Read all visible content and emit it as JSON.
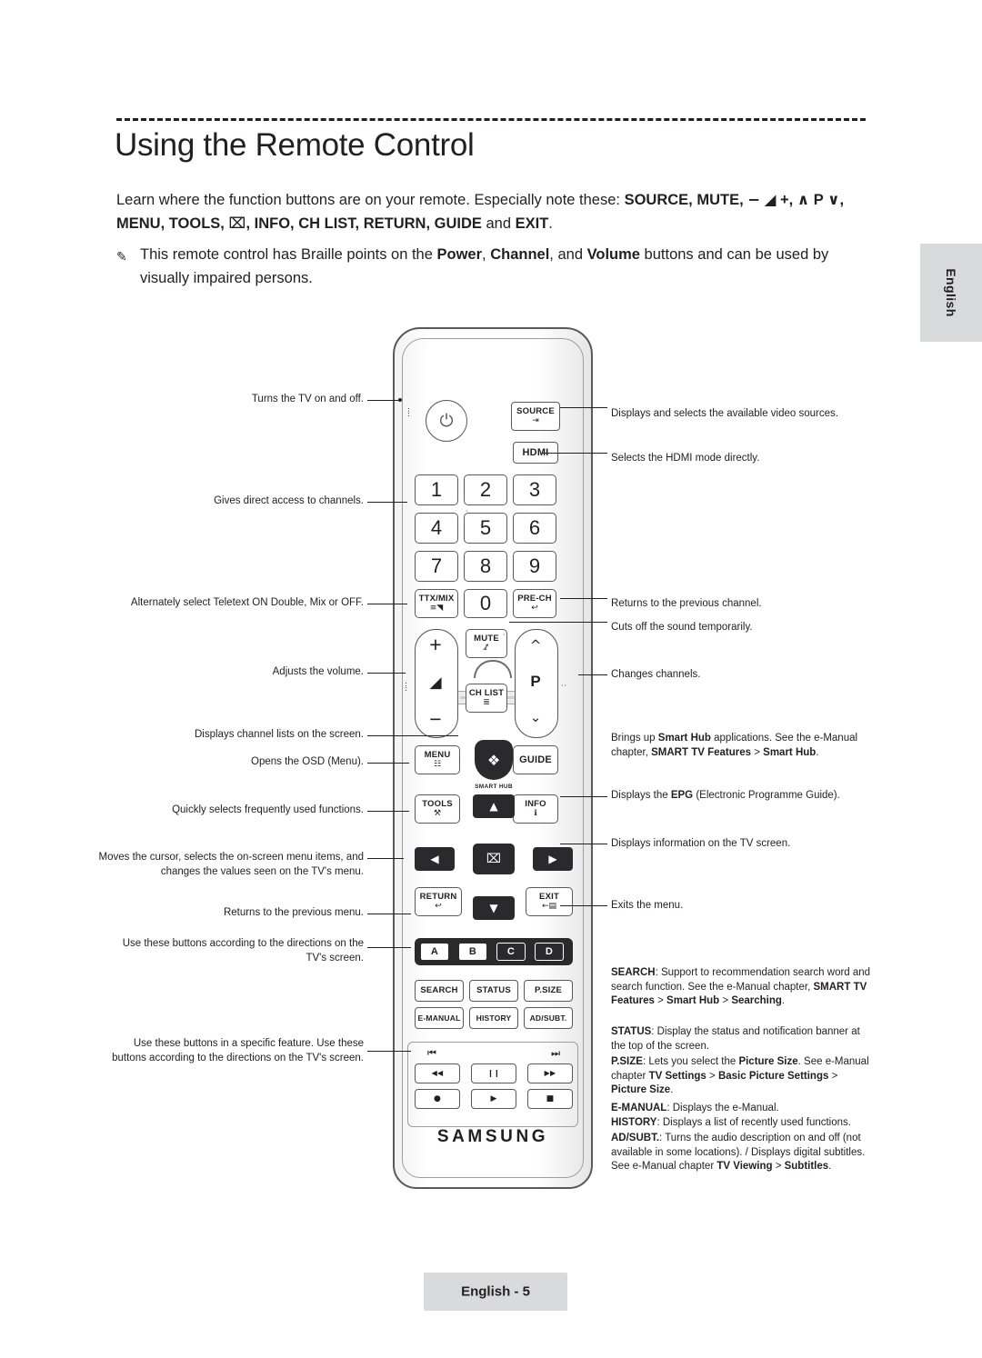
{
  "page": {
    "title": "Using the Remote Control",
    "intro_html": "Learn where the function buttons are on your remote. Especially note these: <b>SOURCE, MUTE, <span class=\"sym\">−</span> <span class=\"sym\">◢</span> +, <span class=\"sym\">∧</span> P <span class=\"sym\">∨</span>, MENU, TOOLS, <span class=\"sym\">⌧</span>, INFO, CH LIST, RETURN, GUIDE</b> and <b>EXIT</b>.",
    "note_html": "This remote control has Braille points on the <b>Power</b>, <b>Channel</b>, and <b>Volume</b> buttons and can be used by visually impaired persons.",
    "side_tab": "English",
    "footer": "English - 5",
    "brand": "SAMSUNG"
  },
  "remote": {
    "keys": {
      "source": {
        "label": "SOURCE",
        "glyph": "⇥"
      },
      "hdmi": {
        "label": "HDMI"
      },
      "n1": "1",
      "n2": "2",
      "n3": "3",
      "n4": "4",
      "n5": "5",
      "n6": "6",
      "n7": "7",
      "n8": "8",
      "n9": "9",
      "n0": "0",
      "ttxmix": {
        "label": "TTX/MIX",
        "glyph": "≡◥"
      },
      "prech": {
        "label": "PRE-CH",
        "glyph": "↩"
      },
      "mute": {
        "label": "MUTE",
        "glyph": "♪̸"
      },
      "chlist": {
        "label": "CH LIST",
        "glyph": "≣"
      },
      "volume_plus": "+",
      "volume_minus": "−",
      "channel": "P",
      "menu": {
        "label": "MENU",
        "glyph": "☷"
      },
      "guide": {
        "label": "GUIDE"
      },
      "smart_hub": "SMART HUB",
      "tools": {
        "label": "TOOLS",
        "glyph": "⚒"
      },
      "info": {
        "label": "INFO",
        "glyph": "ℹ"
      },
      "enter": "⌧",
      "return": {
        "label": "RETURN",
        "glyph": "↩"
      },
      "exit": {
        "label": "EXIT",
        "glyph": "←▤"
      },
      "color_a": "A",
      "color_b": "B",
      "color_c": "C",
      "color_d": "D",
      "search": "SEARCH",
      "status": "STATUS",
      "psize": "P.SIZE",
      "emanual": "E-MANUAL",
      "history": "HISTORY",
      "adsubt": "AD/SUBT.",
      "media": {
        "prev": "⏮",
        "next": "⏭",
        "rew": "◀◀",
        "pause": "❙❙",
        "ff": "▶▶",
        "record": "●",
        "play": "▶",
        "stop": "■"
      }
    }
  },
  "callouts": {
    "left": [
      {
        "id": "power",
        "text": "Turns the TV on and off."
      },
      {
        "id": "numbers",
        "text": "Gives direct access to channels."
      },
      {
        "id": "ttxmix",
        "text": "Alternately select Teletext ON Double, Mix or OFF."
      },
      {
        "id": "volume",
        "text": "Adjusts the volume."
      },
      {
        "id": "chlist",
        "text": "Displays channel lists on the screen."
      },
      {
        "id": "menu",
        "text": "Opens the OSD (Menu)."
      },
      {
        "id": "tools",
        "text": "Quickly selects frequently used functions."
      },
      {
        "id": "dpad",
        "text": "Moves the cursor, selects the on-screen menu items, and changes the values seen on the TV's menu."
      },
      {
        "id": "return",
        "text": "Returns to the previous menu."
      },
      {
        "id": "colorbuttons",
        "text": "Use these buttons according to the directions on the TV's screen."
      },
      {
        "id": "mediabuttons",
        "text": "Use these buttons in a specific feature. Use these buttons according to the directions on the TV's screen."
      }
    ],
    "right": [
      {
        "id": "source",
        "text": "Displays and selects the available video sources."
      },
      {
        "id": "hdmi",
        "text": "Selects the HDMI mode directly."
      },
      {
        "id": "prech",
        "text": "Returns to the previous channel."
      },
      {
        "id": "mute",
        "text": "Cuts off the sound temporarily."
      },
      {
        "id": "channel",
        "text": "Changes channels."
      },
      {
        "id": "smarthub_html",
        "text": "Brings up <b>Smart Hub</b> applications. See the e-Manual chapter, <b>SMART TV Features</b> &gt; <b>Smart Hub</b>."
      },
      {
        "id": "guide_html",
        "text": "Displays the <b>EPG</b> (Electronic Programme Guide)."
      },
      {
        "id": "info",
        "text": "Displays information on the TV screen."
      },
      {
        "id": "exit",
        "text": "Exits the menu."
      }
    ],
    "bottom_right_html": [
      "<b>SEARCH</b>: Support to recommendation search word and search function. See the e-Manual chapter, <b>SMART TV Features</b> &gt; <b>Smart Hub</b> &gt; <b>Searching</b>.",
      "<b>STATUS</b>: Display the status and notification banner at the top of the screen.",
      "<b>P.SIZE</b>: Lets you select the <b>Picture Size</b>. See e-Manual chapter <b>TV Settings</b> &gt; <b>Basic Picture Settings</b> &gt; <b>Picture Size</b>.",
      "<b>E-MANUAL</b>: Displays the e-Manual.",
      "<b>HISTORY</b>: Displays a list of recently used functions.",
      "<b>AD/SUBT.</b>: Turns the audio description on and off (not available in some locations). / Displays digital subtitles. See e-Manual chapter <b>TV Viewing</b> &gt; <b>Subtitles</b>."
    ]
  }
}
